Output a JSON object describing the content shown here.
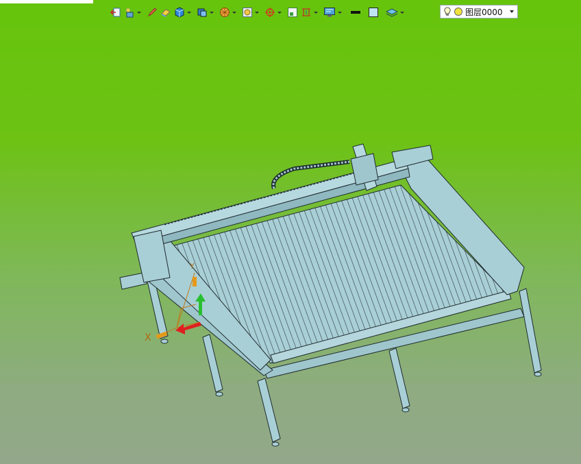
{
  "toolbar": {
    "buttons": [
      {
        "icon": "exit-icon",
        "dropdown": false
      },
      {
        "icon": "material-icon",
        "dropdown": true
      },
      {
        "icon": "pen-icon",
        "dropdown": false
      },
      {
        "icon": "eraser-icon",
        "dropdown": false
      },
      {
        "icon": "solid-cube-icon",
        "dropdown": true
      },
      {
        "icon": "view-cube-icon",
        "dropdown": true
      },
      {
        "icon": "render-sphere-icon",
        "dropdown": true
      },
      {
        "icon": "zoom-icon",
        "dropdown": true
      },
      {
        "icon": "rotate-icon",
        "dropdown": true
      },
      {
        "icon": "frame-icon",
        "dropdown": false
      },
      {
        "icon": "dimension-icon",
        "dropdown": true
      },
      {
        "icon": "display-icon",
        "dropdown": true
      },
      {
        "icon": "line-style-icon",
        "dropdown": false
      },
      {
        "icon": "fill-color-icon",
        "dropdown": false
      },
      {
        "icon": "layer-stack-icon",
        "dropdown": true
      }
    ],
    "layer_select": {
      "value": "图层0000"
    }
  },
  "viewport": {
    "axis_x_label": "X",
    "axis_y_label": "Y"
  },
  "colors": {
    "background_top": "#66c40c",
    "background_bottom": "#93a88a",
    "model_fill": "#a9cfd6",
    "model_edge": "#1e2a2e"
  }
}
